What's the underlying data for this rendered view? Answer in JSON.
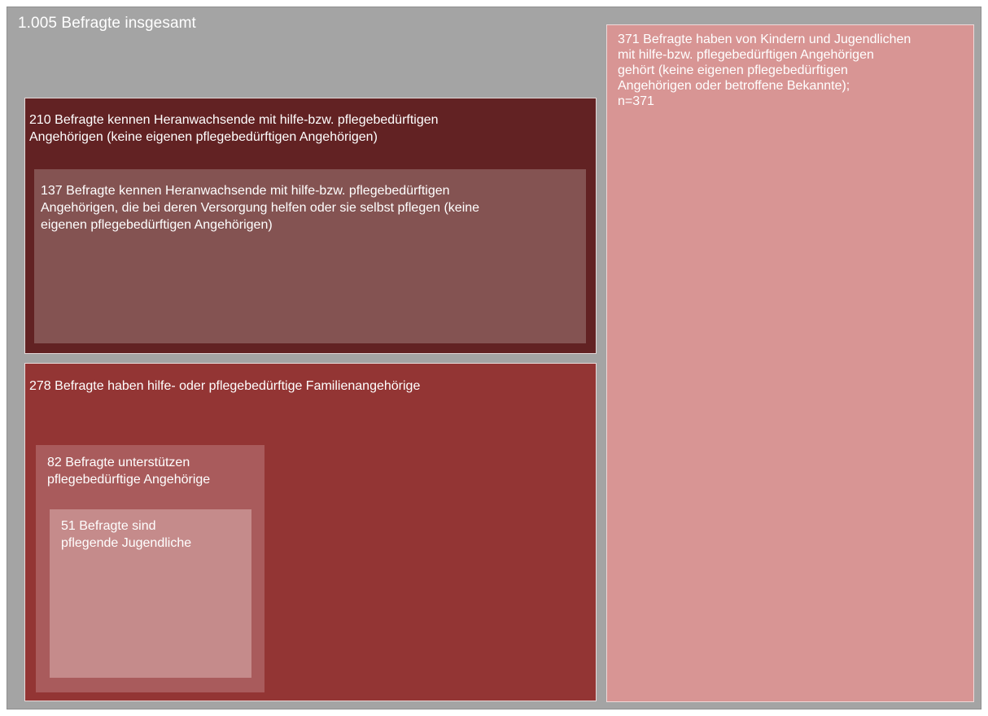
{
  "total": {
    "label": "1.005 Befragte insgesamt"
  },
  "groups": {
    "acquaintances_210": {
      "label": "210 Befragte kennen Heranwachsende mit hilfe-bzw. pflegebedürftigen\nAngehörigen (keine eigenen pflegebedürftigen Angehörigen)",
      "color": "#622223"
    },
    "acquaintances_caring_137": {
      "label": "137 Befragte kennen Heranwachsende mit hilfe-bzw. pflegebedürftigen\nAngehörigen, die bei deren Versorgung helfen oder sie selbst pflegen (keine\neigenen pflegebedürftigen Angehörigen)",
      "color": "#845352"
    },
    "own_family_278": {
      "label": "278 Befragte haben hilfe- oder pflegebedürftige Familienangehörige",
      "color": "#933534"
    },
    "supporting_82": {
      "label": "82 Befragte unterstützen\npflegebedürftige Angehörige",
      "color": "#a95b5c"
    },
    "young_carers_51": {
      "label": "51 Befragte sind\npflegende Jugendliche",
      "color": "#c58b8b"
    },
    "heard_of_371": {
      "label": "371 Befragte haben von Kindern und Jugendlichen\nmit hilfe-bzw. pflegebedürftigen Angehörigen\ngehört  (keine eigenen pflegebedürftigen\nAngehörigen oder betroffene Bekannte);\nn=371",
      "color": "#d89594"
    }
  }
}
